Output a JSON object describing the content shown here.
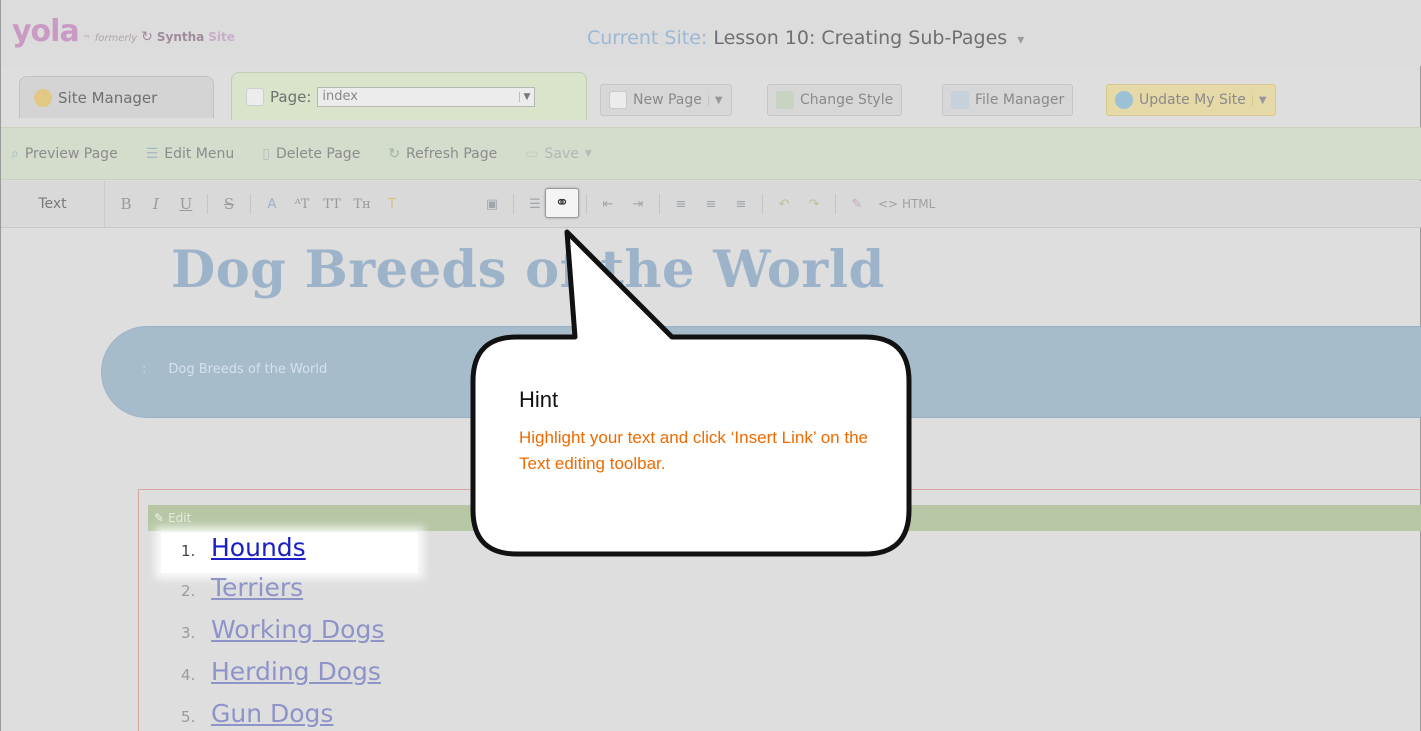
{
  "brand": {
    "logo": "yola",
    "tm": "™",
    "formerly": "formerly",
    "former_brand_part1": "Syntha",
    "former_brand_part2": "Site"
  },
  "current_site": {
    "label": "Current Site:",
    "name": "Lesson 10: Creating Sub-Pages",
    "caret": "▾"
  },
  "tabs": {
    "site_manager": "Site Manager",
    "page_label": "Page:",
    "page_value": "index"
  },
  "toolbar": {
    "new_page": "New Page",
    "change_style": "Change Style",
    "file_manager": "File Manager",
    "update_site": "Update My Site"
  },
  "page_actions": [
    {
      "label": "Preview Page",
      "icon": "magnifier-icon"
    },
    {
      "label": "Edit Menu",
      "icon": "menu-icon"
    },
    {
      "label": "Delete Page",
      "icon": "trash-icon"
    },
    {
      "label": "Refresh Page",
      "icon": "refresh-icon"
    },
    {
      "label": "Save",
      "icon": "save-icon"
    }
  ],
  "text_toolbar": {
    "label": "Text",
    "bold": "B",
    "italic": "I",
    "underline": "U",
    "strike": "S",
    "html_label": "HTML"
  },
  "page": {
    "site_title": "Dog Breeds of the World",
    "nav_separator": ":",
    "nav_item": "Dog Breeds of the World",
    "edit_label": "Edit"
  },
  "breeds": [
    {
      "num": "1.",
      "name": "Hounds"
    },
    {
      "num": "2.",
      "name": "Terriers"
    },
    {
      "num": "3.",
      "name": "Working Dogs"
    },
    {
      "num": "4.",
      "name": "Herding Dogs"
    },
    {
      "num": "5.",
      "name": "Gun Dogs"
    }
  ],
  "hint": {
    "title": "Hint",
    "body": "Highlight your text and click ‘Insert Link’ on the Text editing toolbar."
  },
  "colors": {
    "hint_text": "#ef6a00",
    "link_active": "#1a20c4",
    "nav_band": "#a7bccb"
  }
}
